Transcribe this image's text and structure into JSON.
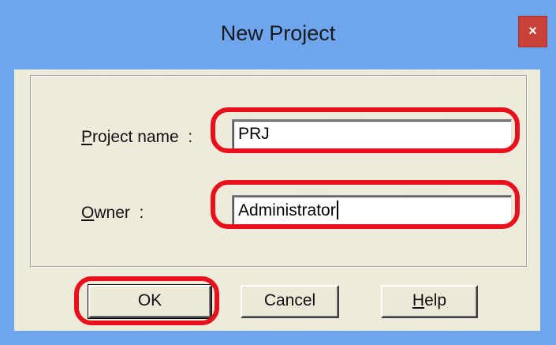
{
  "window": {
    "title": "New Project",
    "close_label": "×"
  },
  "form": {
    "project_label_prefix": "P",
    "project_label_rest": "roject name  :",
    "project_value": "PRJ",
    "owner_label_prefix": "O",
    "owner_label_rest": "wner  :",
    "owner_value": "Administrator"
  },
  "buttons": {
    "ok": "OK",
    "cancel": "Cancel",
    "help_prefix": "H",
    "help_rest": "elp"
  },
  "colors": {
    "titlebar": "#6fa5ee",
    "highlight": "#e8101c",
    "close": "#c8423a"
  }
}
